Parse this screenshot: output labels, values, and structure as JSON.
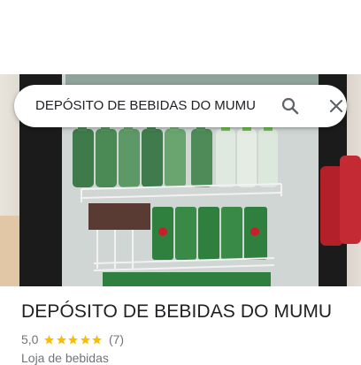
{
  "search": {
    "query": "DEPÓSITO DE BEBIDAS DO MUMU",
    "search_icon": "search-icon",
    "close_icon": "close-icon"
  },
  "place": {
    "title": "DEPÓSITO DE BEBIDAS DO MUMU",
    "rating": "5,0",
    "stars": 5,
    "review_count": "(7)",
    "category": "Loja de bebidas"
  },
  "colors": {
    "star": "#fbbc04",
    "text_primary": "#202124",
    "text_secondary": "#70757a",
    "icon": "#5f6368"
  }
}
